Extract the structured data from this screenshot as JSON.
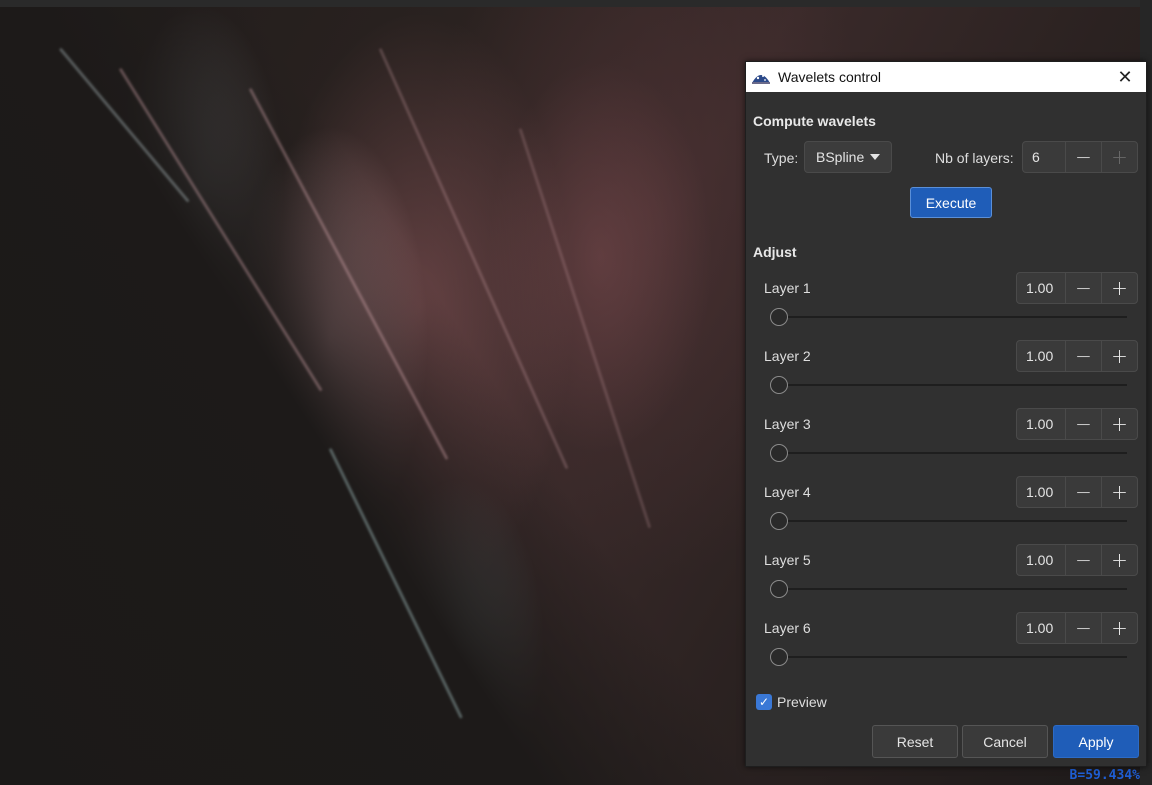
{
  "image_overlay": {
    "readout": "B=59.434%"
  },
  "dialog": {
    "title": "Wavelets control",
    "compute_section": {
      "heading": "Compute wavelets",
      "type_label": "Type:",
      "type_value": "BSpline",
      "layers_label": "Nb of layers:",
      "layers_value": "6",
      "execute_label": "Execute"
    },
    "adjust_section": {
      "heading": "Adjust",
      "layers": [
        {
          "label": "Layer 1",
          "value": "1.00",
          "slider_fraction": 0.0
        },
        {
          "label": "Layer 2",
          "value": "1.00",
          "slider_fraction": 0.0
        },
        {
          "label": "Layer 3",
          "value": "1.00",
          "slider_fraction": 0.0
        },
        {
          "label": "Layer 4",
          "value": "1.00",
          "slider_fraction": 0.0
        },
        {
          "label": "Layer 5",
          "value": "1.00",
          "slider_fraction": 0.0
        },
        {
          "label": "Layer 6",
          "value": "1.00",
          "slider_fraction": 0.0
        }
      ]
    },
    "preview_label": "Preview",
    "preview_checked": true,
    "buttons": {
      "reset": "Reset",
      "cancel": "Cancel",
      "apply": "Apply"
    },
    "spin_minus": "−",
    "spin_plus": "+",
    "close_glyph": "✕"
  },
  "colors": {
    "accent": "#1f5db8",
    "readout": "#1f5fd6",
    "dialog_bg": "#303030"
  },
  "icons": [
    "app-icon",
    "close-icon",
    "dropdown-arrow-icon",
    "minus-icon",
    "plus-icon",
    "checkmark-icon"
  ]
}
